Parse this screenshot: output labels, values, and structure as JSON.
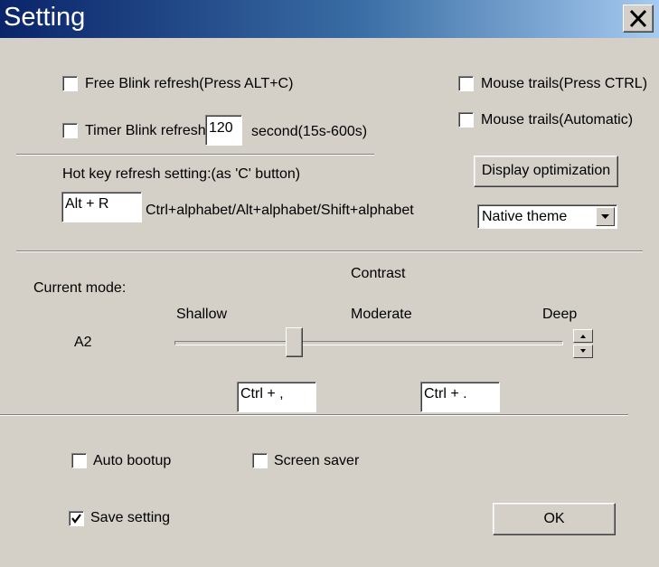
{
  "window": {
    "title": "Setting"
  },
  "icons": {
    "close": "close-icon",
    "dropdown": "chevron-down-icon",
    "spin_up": "arrow-up-icon",
    "spin_down": "arrow-down-icon",
    "check": "check-icon"
  },
  "options": {
    "free_blink": {
      "label": "Free Blink refresh(Press ALT+C)",
      "checked": false
    },
    "timer_blink": {
      "label": "Timer Blink refresh",
      "checked": false,
      "value": "120",
      "suffix": "second(15s-600s)"
    },
    "mouse_trails_ctrl": {
      "label": "Mouse trails(Press CTRL)",
      "checked": false
    },
    "mouse_trails_auto": {
      "label": "Mouse trails(Automatic)",
      "checked": false
    }
  },
  "hotkey": {
    "label": "Hot key refresh setting:(as 'C' button)",
    "value": "Alt + R",
    "hint": "Ctrl+alphabet/Alt+alphabet/Shift+alphabet"
  },
  "display": {
    "optimize_label": "Display optimization",
    "theme_value": "Native theme"
  },
  "contrast": {
    "title": "Contrast",
    "current_mode_label": "Current mode:",
    "current_mode_value": "A2",
    "shallow": "Shallow",
    "moderate": "Moderate",
    "deep": "Deep",
    "slider_fraction": 0.31,
    "shortcut_left": "Ctrl + ,",
    "shortcut_right": "Ctrl + ."
  },
  "footer": {
    "auto_bootup": {
      "label": "Auto bootup",
      "checked": false
    },
    "screen_saver": {
      "label": "Screen saver",
      "checked": false
    },
    "save_setting": {
      "label": "Save setting",
      "checked": true
    },
    "ok_label": "OK"
  }
}
